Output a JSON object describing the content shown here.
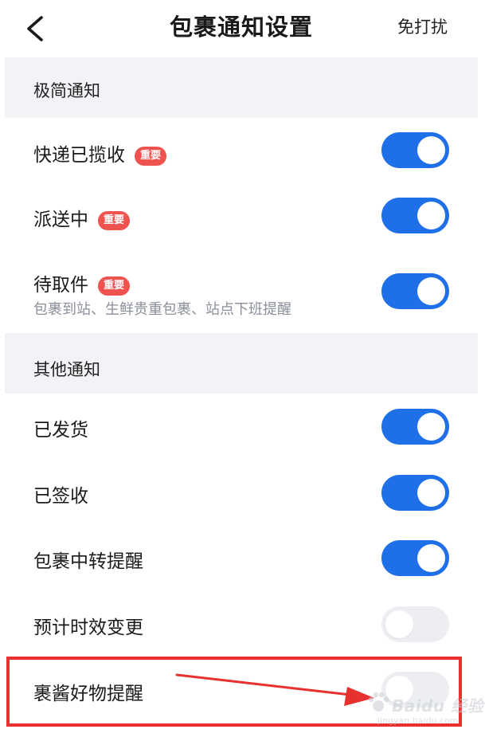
{
  "header": {
    "back_icon": "chevron-left-icon",
    "title": "包裹通知设置",
    "dnd_label": "免打扰"
  },
  "sections": [
    {
      "title": "极简通知",
      "items": [
        {
          "label": "快递已揽收",
          "badge": "重要",
          "enabled": true
        },
        {
          "label": "派送中",
          "badge": "重要",
          "enabled": true
        },
        {
          "label": "待取件",
          "badge": "重要",
          "subtitle": "包裹到站、生鲜贵重包裹、站点下班提醒",
          "enabled": true
        }
      ]
    },
    {
      "title": "其他通知",
      "items": [
        {
          "label": "已发货",
          "enabled": true
        },
        {
          "label": "已签收",
          "enabled": true
        },
        {
          "label": "包裹中转提醒",
          "enabled": true
        },
        {
          "label": "预计时效变更",
          "enabled": false
        },
        {
          "label": "裹酱好物提醒",
          "enabled": false
        }
      ]
    }
  ],
  "watermark": {
    "brand": "Baidu 经验",
    "url": "jingyan.baidu.com"
  },
  "colors": {
    "toggle_on": "#1f6fe8",
    "toggle_off": "#eceef2",
    "badge": "#ef5350",
    "section_bg": "#f2f3f7",
    "annotation_red": "#e8302f"
  }
}
